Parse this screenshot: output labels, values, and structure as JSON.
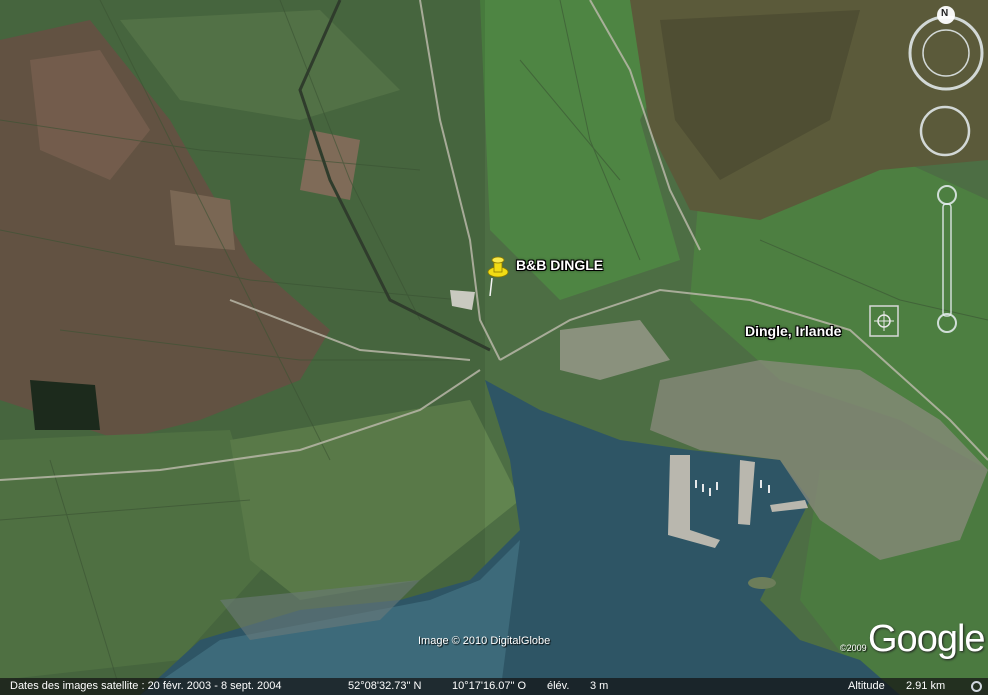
{
  "labels": {
    "bnb": "B&B DINGLE",
    "town": "Dingle, Irlande"
  },
  "attribution": {
    "imagery": "Image © 2010 DigitalGlobe",
    "logo": "Google",
    "logo_year": "©2009"
  },
  "navigation": {
    "north": "N"
  },
  "statusbar": {
    "imagery_dates": "Dates des images satellite : 20 févr. 2003 - 8 sept. 2004",
    "latitude": "52°08'32.73\" N",
    "longitude": "10°17'16.07\" O",
    "elevation_label": "élév.",
    "elevation_value": "3 m",
    "altitude_label": "Altitude",
    "altitude_value": "2.91 km"
  },
  "colors": {
    "pin": "#f2dc14",
    "water": "#2c5a6c",
    "fields": "#4f7a45"
  },
  "icons": {
    "placemark": "yellow-pushpin-icon",
    "compass": "compass-ring-icon",
    "look": "look-joystick-icon",
    "zoom": "zoom-slider-icon"
  }
}
